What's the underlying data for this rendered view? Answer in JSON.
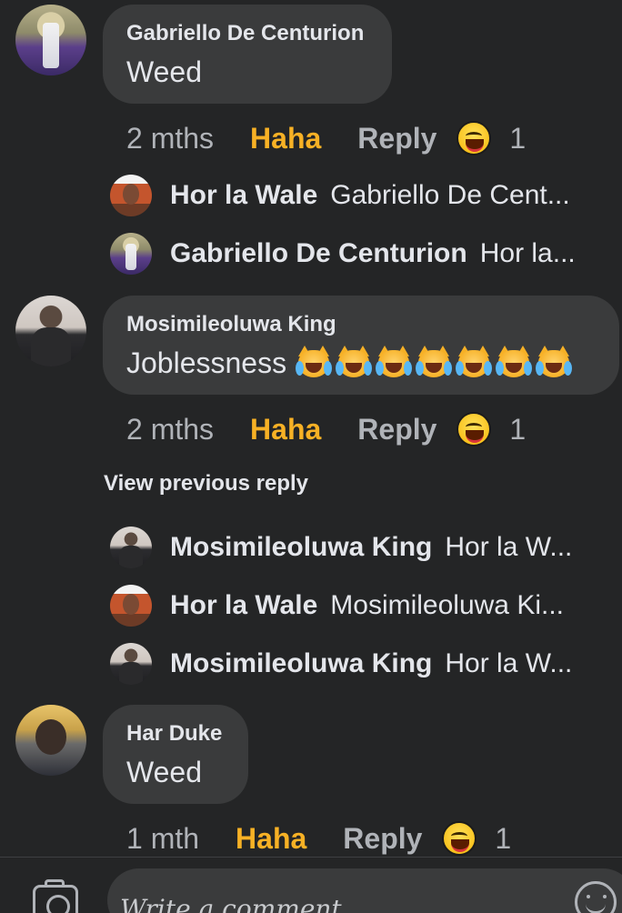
{
  "comments": [
    {
      "author": "Gabriello De Centurion",
      "text": "Weed",
      "time": "2 mths",
      "reaction_label": "Haha",
      "reply_label": "Reply",
      "reaction_icon": "haha-emoji-icon",
      "reaction_count": "1",
      "replies": [
        {
          "name": "Hor la Wale",
          "preview": "Gabriello De Cent..."
        },
        {
          "name": "Gabriello De Centurion",
          "preview": "Hor la..."
        }
      ]
    },
    {
      "author": "Mosimileoluwa King",
      "text": "Joblessness",
      "text_emojis": [
        "crying-laughing-cat-icon",
        "crying-laughing-cat-icon",
        "crying-laughing-cat-icon",
        "crying-laughing-cat-icon",
        "crying-laughing-cat-icon",
        "crying-laughing-cat-icon",
        "crying-laughing-cat-icon"
      ],
      "time": "2 mths",
      "reaction_label": "Haha",
      "reply_label": "Reply",
      "reaction_icon": "haha-emoji-icon",
      "reaction_count": "1",
      "view_previous": "View previous reply",
      "replies": [
        {
          "name": "Mosimileoluwa King",
          "preview": "Hor la W..."
        },
        {
          "name": "Hor la Wale",
          "preview": "Mosimileoluwa Ki..."
        },
        {
          "name": "Mosimileoluwa King",
          "preview": "Hor la W..."
        }
      ]
    },
    {
      "author": "Har Duke",
      "text": "Weed",
      "time": "1 mth",
      "reaction_label": "Haha",
      "reply_label": "Reply",
      "reaction_icon": "haha-emoji-icon",
      "reaction_count": "1"
    }
  ],
  "composer": {
    "placeholder": "Write a comment...",
    "left_icon": "camera-icon",
    "right_icon": "smiley-icon"
  },
  "colors": {
    "background": "#242526",
    "bubble": "#3a3b3c",
    "haha": "#f7b125",
    "muted": "#b0b3b8"
  }
}
